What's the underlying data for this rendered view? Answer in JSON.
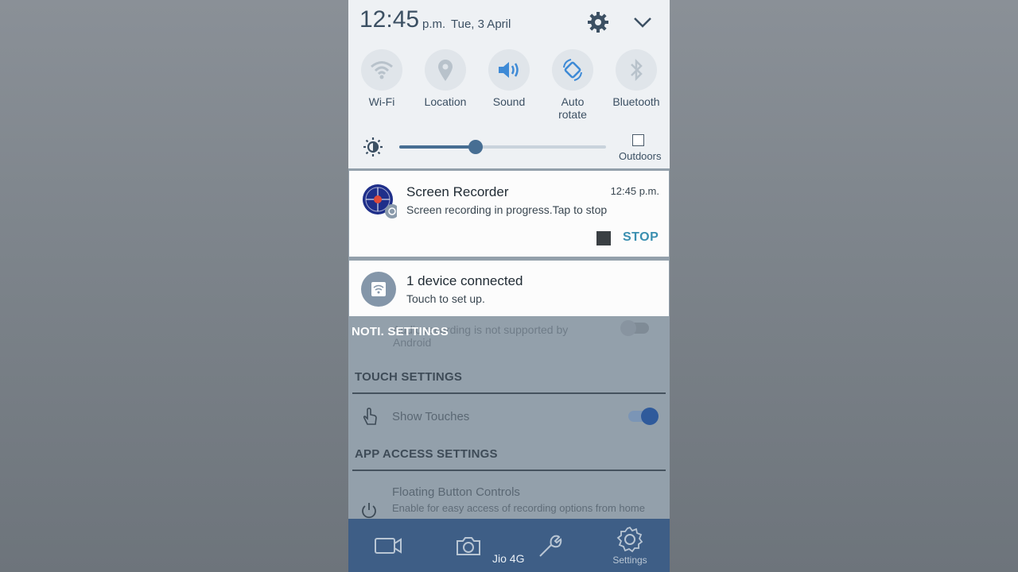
{
  "status": {
    "time": "12:45",
    "ampm": "p.m.",
    "date": "Tue, 3 April"
  },
  "quick_settings": [
    {
      "label": "Wi-Fi",
      "icon": "wifi-icon",
      "active": false
    },
    {
      "label": "Location",
      "icon": "location-pin-icon",
      "active": false
    },
    {
      "label": "Sound",
      "icon": "speaker-icon",
      "active": true
    },
    {
      "label": "Auto\nrotate",
      "icon": "auto-rotate-icon",
      "active": true
    },
    {
      "label": "Bluetooth",
      "icon": "bluetooth-icon",
      "active": false
    }
  ],
  "brightness": {
    "level": 0.37,
    "outdoors_label": "Outdoors",
    "outdoors_checked": false
  },
  "notifications": [
    {
      "title": "Screen Recorder",
      "text": "Screen recording in progress.Tap to stop",
      "time": "12:45 p.m.",
      "action": "STOP"
    },
    {
      "title": "1 device connected",
      "text": "Touch to set up."
    }
  ],
  "shade_footer": {
    "noti_settings": "NOTI. SETTINGS",
    "carrier": "Jio 4G"
  },
  "app": {
    "hidden_text_1": "Audio recording is not supported by",
    "hidden_text_2": "Android",
    "touch_settings_header": "TOUCH SETTINGS",
    "show_touches": "Show Touches",
    "show_touches_on": true,
    "app_access_header": "APP ACCESS SETTINGS",
    "floating_title": "Floating Button Controls",
    "floating_sub": "Enable for easy access of recording options from home",
    "tabs": [
      {
        "icon": "video-camera-icon",
        "label": ""
      },
      {
        "icon": "camera-icon",
        "label": ""
      },
      {
        "icon": "wrench-icon",
        "label": ""
      },
      {
        "icon": "settings-gear-icon",
        "label": "Settings"
      }
    ]
  },
  "colors": {
    "shade_bg": "#eef1f4",
    "accent": "#476e93",
    "stop_action": "#3a8fb0",
    "app_bar": "#3e5e86"
  }
}
